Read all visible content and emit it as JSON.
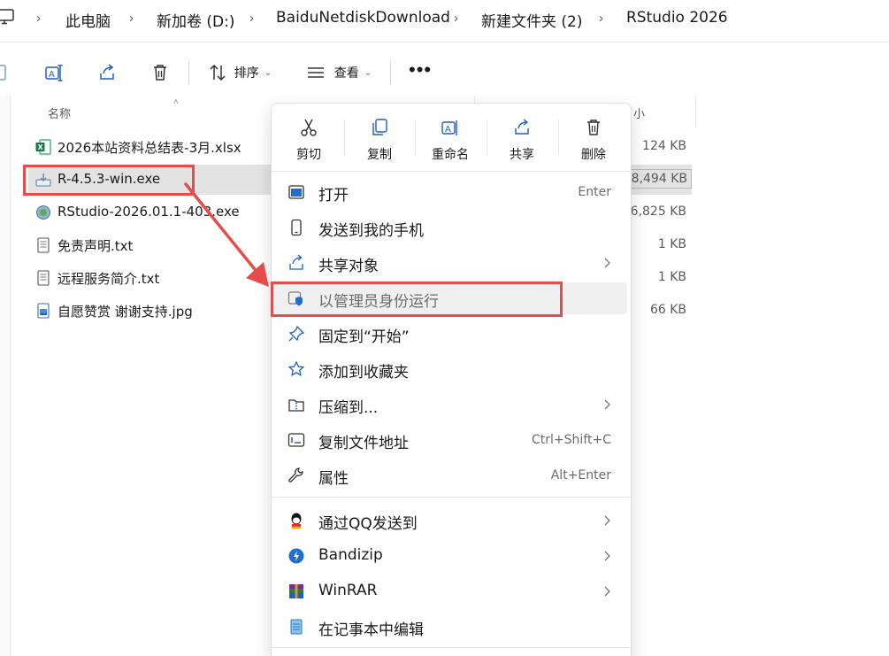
{
  "breadcrumb": [
    "此电脑",
    "新加卷 (D:)",
    "BaiduNetdiskDownload",
    "新建文件夹 (2)",
    "RStudio 2026"
  ],
  "toolbar": {
    "sort_label": "排序",
    "view_label": "查看",
    "more_label": "•••"
  },
  "columns": {
    "name": "名称",
    "size_fragment": "小"
  },
  "files": [
    {
      "name": "2026本站资料总结表-3月.xlsx",
      "size": "124 KB",
      "icon": "excel-file-icon"
    },
    {
      "name": "R-4.5.3-win.exe",
      "size": "8,494 KB",
      "icon": "installer-file-icon"
    },
    {
      "name": "RStudio-2026.01.1-403.exe",
      "size": "6,825 KB",
      "icon": "rstudio-app-icon"
    },
    {
      "name": "免责声明.txt",
      "size": "1 KB",
      "icon": "text-file-icon"
    },
    {
      "name": "远程服务简介.txt",
      "size": "1 KB",
      "icon": "text-file-icon"
    },
    {
      "name": "自愿赞赏 谢谢支持.jpg",
      "size": "66 KB",
      "icon": "image-file-icon"
    }
  ],
  "selected_file_index": 1,
  "context_menu": {
    "quick_actions": [
      {
        "label": "剪切",
        "icon": "scissors-icon"
      },
      {
        "label": "复制",
        "icon": "copy-icon"
      },
      {
        "label": "重命名",
        "icon": "rename-icon"
      },
      {
        "label": "共享",
        "icon": "share-icon"
      },
      {
        "label": "删除",
        "icon": "trash-icon"
      }
    ],
    "items": [
      {
        "label": "打开",
        "shortcut": "Enter",
        "icon": "open-window-icon"
      },
      {
        "label": "发送到我的手机",
        "shortcut": "",
        "icon": "phone-icon"
      },
      {
        "label": "共享对象",
        "shortcut": "",
        "icon": "share-icon",
        "submenu": true
      },
      {
        "label": "以管理员身份运行",
        "shortcut": "",
        "icon": "admin-shield-icon",
        "highlighted": true
      },
      {
        "label": "固定到“开始”",
        "shortcut": "",
        "icon": "pin-icon"
      },
      {
        "label": "添加到收藏夹",
        "shortcut": "",
        "icon": "star-icon"
      },
      {
        "label": "压缩到...",
        "shortcut": "",
        "icon": "zip-folder-icon",
        "submenu": true
      },
      {
        "label": "复制文件地址",
        "shortcut": "Ctrl+Shift+C",
        "icon": "path-icon"
      },
      {
        "label": "属性",
        "shortcut": "Alt+Enter",
        "icon": "wrench-icon"
      },
      {
        "label": "通过QQ发送到",
        "shortcut": "",
        "icon": "qq-icon",
        "submenu": true
      },
      {
        "label": "Bandizip",
        "shortcut": "",
        "icon": "bandizip-icon",
        "submenu": true
      },
      {
        "label": "WinRAR",
        "shortcut": "",
        "icon": "winrar-icon",
        "submenu": true
      },
      {
        "label": "在记事本中编辑",
        "shortcut": "",
        "icon": "notepad-icon"
      }
    ]
  },
  "colors": {
    "annotation_red": "#e74c4c",
    "selection_gray": "#e3e3e3",
    "accent_blue": "#1f6fd1"
  }
}
